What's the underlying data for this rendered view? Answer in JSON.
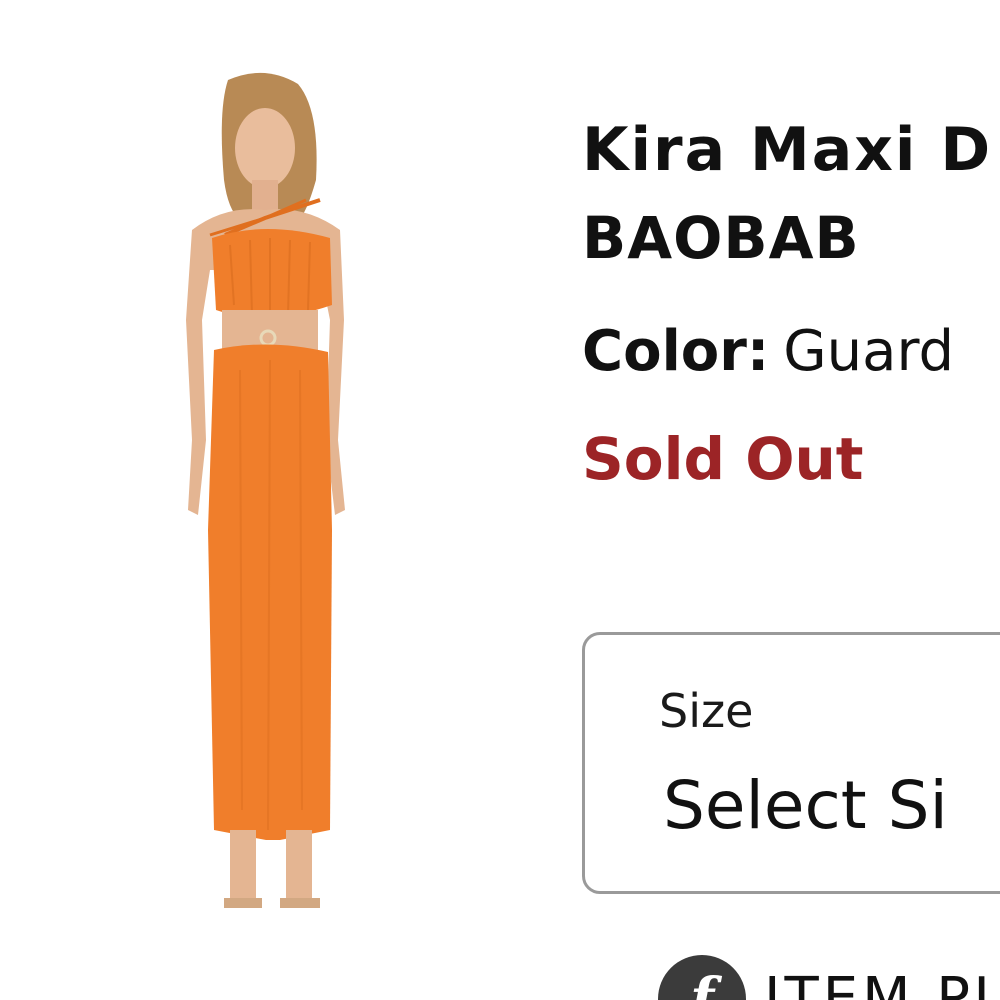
{
  "product": {
    "title_line1": "Kira Maxi D",
    "brand": "BAOBAB",
    "color_label": "Color:",
    "color_value": "Guard",
    "stock_status": "Sold Out"
  },
  "size_selector": {
    "label": "Size",
    "value": "Select Si"
  },
  "bottom_banner": {
    "icon_letter": "f",
    "text": "ITEM PU"
  },
  "colors": {
    "stock_status": "#9c2426",
    "dress": "#f07e2b",
    "border": "#9a9a9a"
  },
  "icons": {
    "brand_icon": "fwrd-logo-icon"
  }
}
